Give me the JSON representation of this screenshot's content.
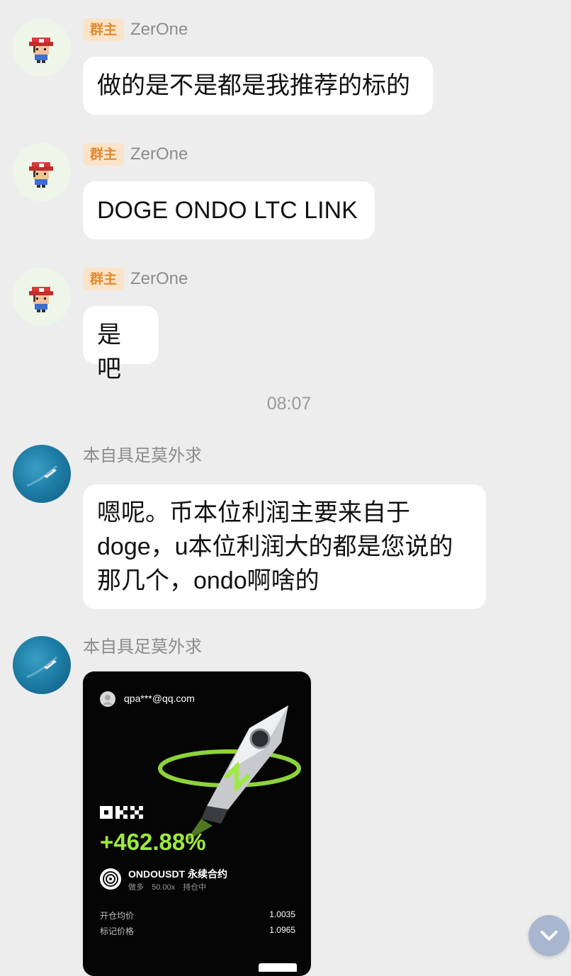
{
  "messages": [
    {
      "badge": "群主",
      "sender": "ZerOne",
      "lines": [
        "做的是不是都是我推荐的标的"
      ]
    },
    {
      "badge": "群主",
      "sender": "ZerOne",
      "lines": [
        "DOGE ONDO LTC LINK"
      ]
    },
    {
      "badge": "群主",
      "sender": "ZerOne",
      "lines": [
        "是吧"
      ]
    },
    {
      "sender": "本自具足莫外求",
      "lines": [
        "嗯呢。币本位利润主要来自于",
        "doge，u本位利润大的都是您说的",
        "那几个，ondo啊啥的"
      ]
    },
    {
      "sender": "本自具足莫外求"
    }
  ],
  "timestamp": "08:07",
  "share_card": {
    "email": "qpa***@qq.com",
    "brand": "OKX",
    "pnl_percent": "+462.88%",
    "symbol": "ONDOUSDT 永续合约",
    "side": "做多",
    "leverage": "50.00x",
    "status": "持仓中",
    "open_price_label": "开仓均价",
    "open_price": "1.0035",
    "mark_price_label": "标记价格",
    "mark_price": "1.0965"
  },
  "colors": {
    "background": "#ededed",
    "bubble": "#ffffff",
    "badge_bg": "#fbe3c8",
    "badge_text": "#e08a2e",
    "pnl_green": "#9dea3f"
  },
  "icons": {
    "avatar_admin": "pixel-character-red-cap",
    "avatar_member": "boat-on-sea",
    "scroll_button": "chevron-down-icon"
  }
}
